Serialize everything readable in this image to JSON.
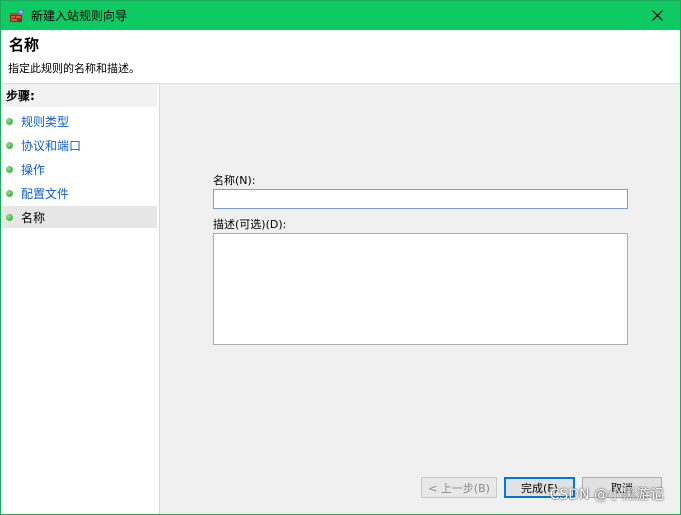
{
  "window": {
    "title": "新建入站规则向导",
    "header_title": "名称",
    "header_description": "指定此规则的名称和描述。"
  },
  "steps": {
    "heading": "步骤:",
    "items": [
      {
        "label": "规则类型",
        "state": "link"
      },
      {
        "label": "协议和端口",
        "state": "link"
      },
      {
        "label": "操作",
        "state": "link"
      },
      {
        "label": "配置文件",
        "state": "link"
      },
      {
        "label": "名称",
        "state": "current"
      }
    ]
  },
  "form": {
    "name_label": "名称(N):",
    "name_value": "",
    "description_label": "描述(可选)(D):",
    "description_value": ""
  },
  "buttons": {
    "back": "< 上一步(B)",
    "finish": "完成(F)",
    "cancel": "取消"
  },
  "watermark": "CSDN @小黑游记",
  "colors": {
    "titlebar": "#0dca62",
    "link": "#1060c8",
    "step_dot": "#1f9d1f",
    "focus_border": "#0078d7"
  },
  "icons": {
    "app": "firewall-wizard-icon",
    "close": "close-icon",
    "step_bullet": "green-dot-icon"
  }
}
